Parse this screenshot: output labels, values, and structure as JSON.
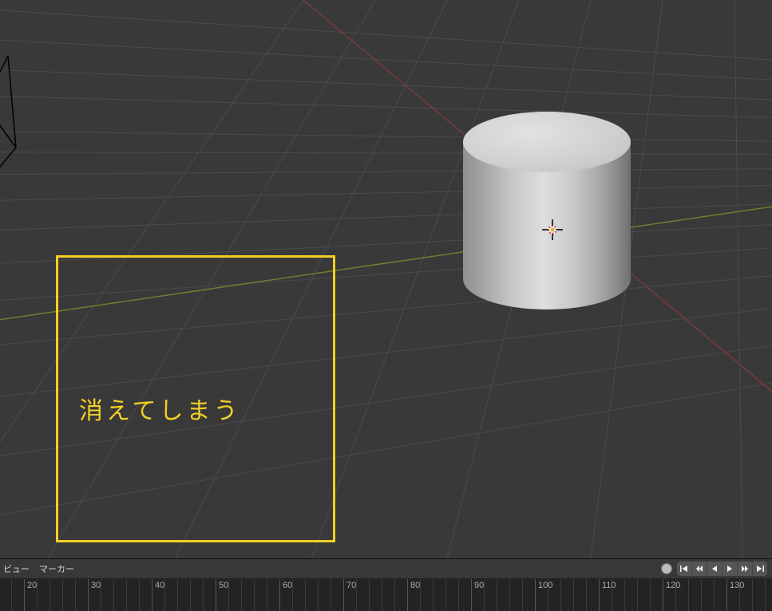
{
  "viewport": {
    "annotation_text": "消えてしまう"
  },
  "timeline": {
    "menus": [
      "ビュー",
      "マーカー"
    ],
    "ticks": [
      20,
      30,
      40,
      50,
      60,
      70,
      80,
      90,
      100,
      110,
      120,
      130
    ],
    "controls": {
      "record": "auto-keying",
      "buttons": [
        "jump-start",
        "prev-keyframe",
        "play-reverse",
        "play",
        "next-keyframe",
        "jump-end"
      ]
    }
  }
}
